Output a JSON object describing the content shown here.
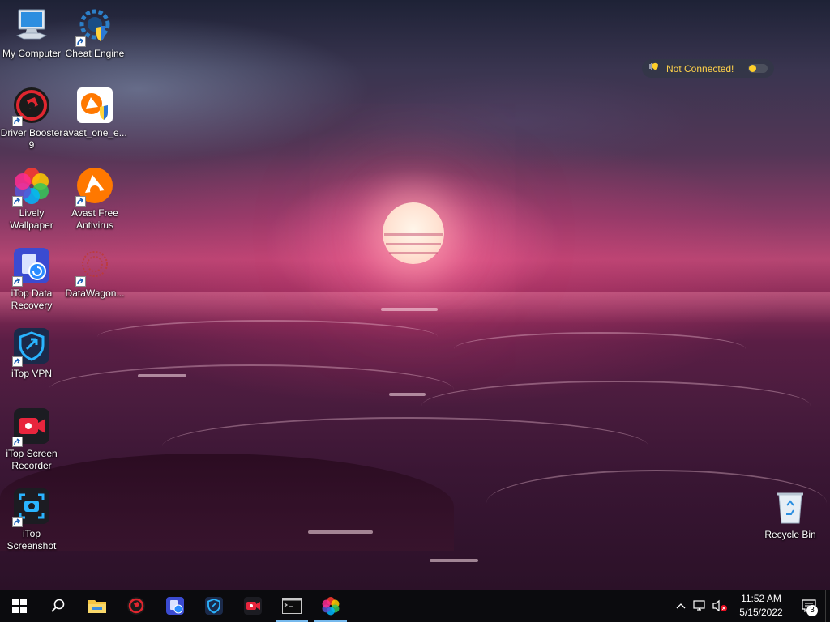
{
  "desktop_icons": [
    {
      "label": "My Computer"
    },
    {
      "label": "Cheat Engine"
    },
    {
      "label": "Driver Booster\n9"
    },
    {
      "label": "avast_one_e..."
    },
    {
      "label": "Lively\nWallpaper"
    },
    {
      "label": "Avast Free\nAntivirus"
    },
    {
      "label": "iTop Data\nRecovery"
    },
    {
      "label": "DataWagon..."
    },
    {
      "label": "iTop VPN"
    },
    {
      "label": "iTop Screen\nRecorder"
    },
    {
      "label": "iTop\nScreenshot"
    },
    {
      "label": "Recycle Bin"
    }
  ],
  "vpn_widget": {
    "status": "Not Connected!",
    "status_color": "#ffd24a"
  },
  "taskbar": {
    "apps": [
      "file-explorer",
      "driver-booster",
      "itop-data-recovery",
      "itop-vpn",
      "itop-screen-recorder",
      "command-prompt",
      "lively-wallpaper"
    ],
    "running": [
      "command-prompt",
      "lively-wallpaper"
    ]
  },
  "tray": {
    "time": "11:52 AM",
    "date": "5/15/2022",
    "notification_count": "3"
  },
  "colors": {
    "taskbar": "#0b0b0e",
    "running_indicator": "#76b9ed"
  }
}
